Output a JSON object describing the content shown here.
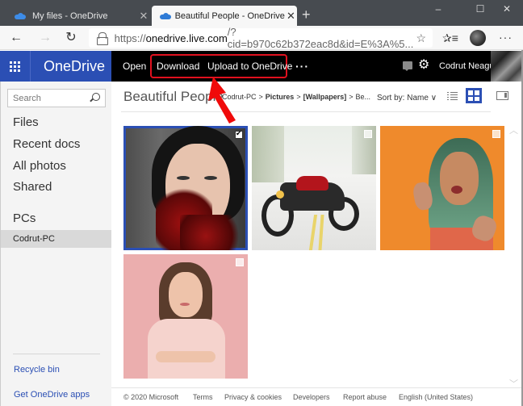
{
  "browser": {
    "tabs": [
      {
        "title": "My files - OneDrive",
        "active": false
      },
      {
        "title": "Beautiful People - OneDrive",
        "active": true
      }
    ],
    "new_tab_icon": "plus-icon",
    "window_controls": {
      "minimize": "–",
      "maximize": "☐",
      "close": "✕"
    },
    "address": {
      "scheme": "https://",
      "host": "onedrive.live.com",
      "rest": "/?cid=b970c62b372eac8d&id=E%3A%5..."
    },
    "nav": {
      "back": "←",
      "forward": "→",
      "refresh": "↻"
    },
    "icons": {
      "favorite": "☆",
      "favorites_list": "✰≡",
      "more": "···"
    }
  },
  "onedrive": {
    "app_name": "OneDrive",
    "commands": {
      "open": "Open",
      "download": "Download",
      "upload": "Upload to OneDrive",
      "more": "···"
    },
    "user_name": "Codrut Neagu",
    "settings_icon": "⚙"
  },
  "sidebar": {
    "search_placeholder": "Search",
    "nav_items": [
      "Files",
      "Recent docs",
      "All photos",
      "Shared"
    ],
    "pcs_heading": "PCs",
    "pc_selected": "Codrut-PC",
    "bottom_links": [
      "Recycle bin",
      "Get OneDrive apps"
    ]
  },
  "main": {
    "folder_title": "Beautiful People",
    "breadcrumb": [
      "Codrut-PC",
      "Pictures",
      "[Wallpapers]",
      "Be..."
    ],
    "breadcrumb_sep": ">",
    "sort_label": "Sort by: Name ∨",
    "photos": [
      {
        "name": "woman-red-feathers",
        "selected": true
      },
      {
        "name": "motorcycle-road",
        "selected": false
      },
      {
        "name": "woman-green-hair-orange",
        "selected": false
      },
      {
        "name": "woman-pink-background",
        "selected": false
      }
    ]
  },
  "footer": {
    "copyright": "© 2020 Microsoft",
    "links": [
      "Terms",
      "Privacy & cookies",
      "Developers",
      "Report abuse",
      "English (United States)"
    ]
  },
  "colors": {
    "brand_blue": "#2b4fb4",
    "highlight_red": "#e0101e",
    "header_black": "#000000"
  }
}
